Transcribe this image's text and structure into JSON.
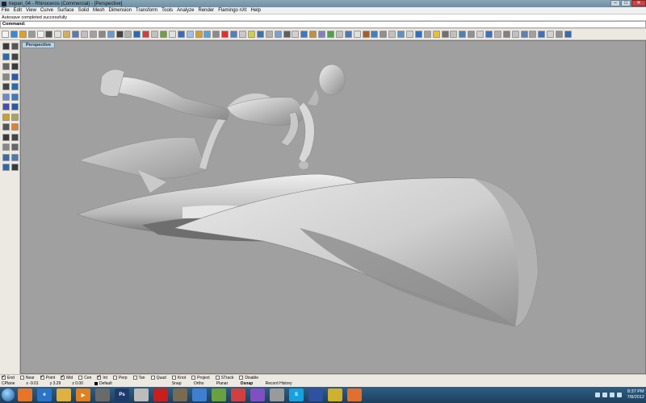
{
  "window": {
    "title": "trepan_04 - Rhinoceros (Commercial) - [Perspective]",
    "min_glyph": "–",
    "max_glyph": "□",
    "close_glyph": "✕"
  },
  "menu": [
    "File",
    "Edit",
    "View",
    "Curve",
    "Surface",
    "Solid",
    "Mesh",
    "Dimension",
    "Transform",
    "Tools",
    "Analyze",
    "Render",
    "Flamingo nXt",
    "Help"
  ],
  "command": {
    "history": "Autosave completed successfully",
    "prompt_label": "Command:",
    "prompt_value": ""
  },
  "viewport": {
    "tab_label": "Perspective",
    "background": "#a0a0a0"
  },
  "osnaps": [
    {
      "label": "End",
      "checked": true
    },
    {
      "label": "Near",
      "checked": false
    },
    {
      "label": "Point",
      "checked": true
    },
    {
      "label": "Mid",
      "checked": true
    },
    {
      "label": "Cen",
      "checked": false
    },
    {
      "label": "Int",
      "checked": true
    },
    {
      "label": "Perp",
      "checked": false
    },
    {
      "label": "Tan",
      "checked": false
    },
    {
      "label": "Quad",
      "checked": false
    },
    {
      "label": "Knot",
      "checked": false
    },
    {
      "label": "Project",
      "checked": false
    },
    {
      "label": "STrack",
      "checked": false
    },
    {
      "label": "Disable",
      "checked": false
    }
  ],
  "status": {
    "cplane": "CPlane",
    "x": "x -9.01",
    "y": "y 3.29",
    "z": "z 0.00",
    "layer": "Default",
    "panes": [
      "Snap",
      "Ortho",
      "Planar",
      "Osnap",
      "Record History"
    ]
  },
  "taskbar": {
    "apps": [
      {
        "name": "firefox",
        "label": "",
        "color": "#e8742a"
      },
      {
        "name": "ie",
        "label": "e",
        "color": "#2a74c8"
      },
      {
        "name": "explorer",
        "label": "",
        "color": "#e0b040"
      },
      {
        "name": "media",
        "label": "▶",
        "color": "#e08020"
      },
      {
        "name": "chess",
        "label": "",
        "color": "#6a6a6a"
      },
      {
        "name": "photoshop",
        "label": "Ps",
        "color": "#1d3a6c"
      },
      {
        "name": "rhino-app",
        "label": "",
        "color": "#bcbcbc"
      },
      {
        "name": "flash",
        "label": "",
        "color": "#c81e1e"
      },
      {
        "name": "gimp",
        "label": "",
        "color": "#7a6a50"
      },
      {
        "name": "app-blue",
        "label": "",
        "color": "#3f7fd0"
      },
      {
        "name": "app-green",
        "label": "",
        "color": "#6aa040"
      },
      {
        "name": "app-red",
        "label": "",
        "color": "#d04040"
      },
      {
        "name": "app-purple",
        "label": "",
        "color": "#8050c0"
      },
      {
        "name": "app-rhino2",
        "label": "",
        "color": "#9a9a9a"
      },
      {
        "name": "skype",
        "label": "S",
        "color": "#18a0e0"
      },
      {
        "name": "app-eye",
        "label": "",
        "color": "#3050a0"
      },
      {
        "name": "app-yellow",
        "label": "",
        "color": "#d0b030"
      },
      {
        "name": "app-orange",
        "label": "",
        "color": "#e07030"
      }
    ],
    "time": "8:37 PM",
    "date": "7/8/2012"
  }
}
